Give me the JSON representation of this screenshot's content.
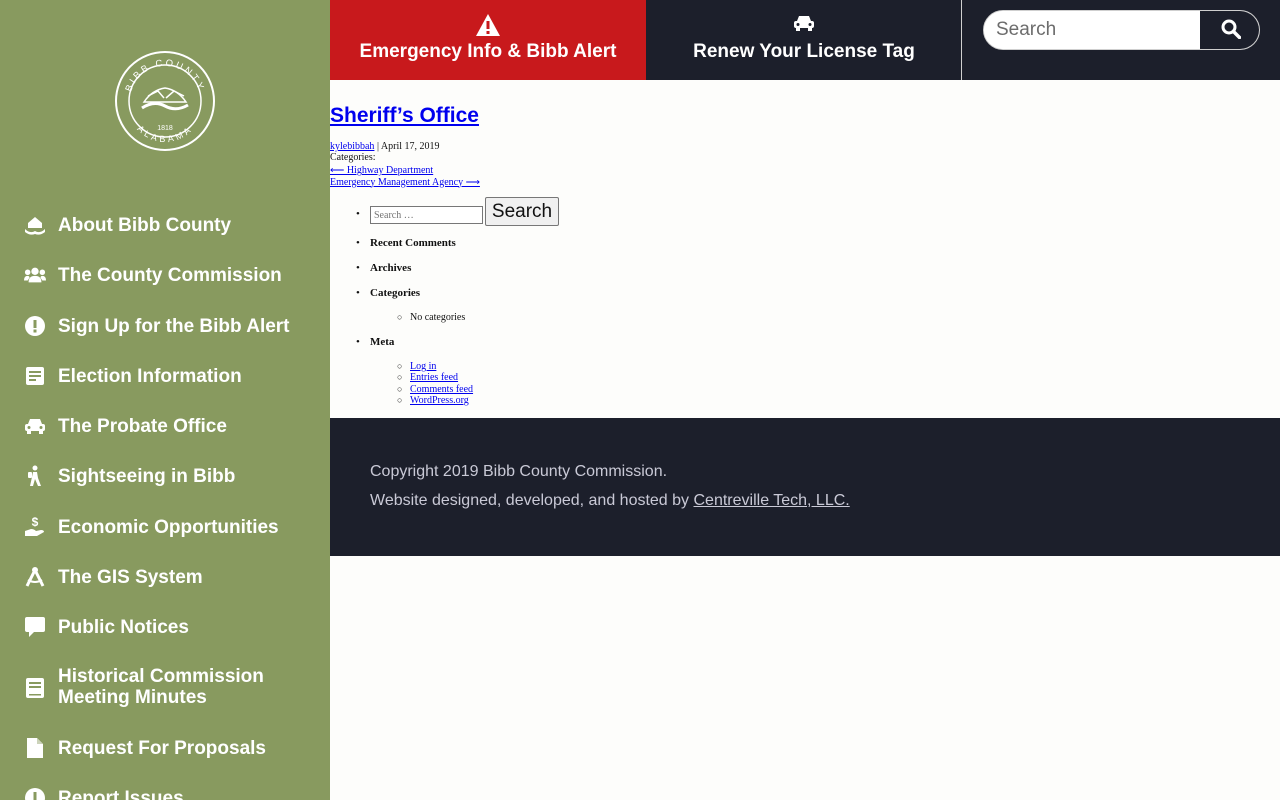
{
  "sidebar": {
    "seal": {
      "text_top": "BIBB COUNTY",
      "text_bottom": "ALABAMA",
      "year": "1818"
    },
    "items": [
      {
        "label": "About Bibb County",
        "icon": "hands-house-icon"
      },
      {
        "label": "The County Commission",
        "icon": "users-icon"
      },
      {
        "label": "Sign Up for the Bibb Alert",
        "icon": "exclamation-circle-icon"
      },
      {
        "label": "Election Information",
        "icon": "document-icon"
      },
      {
        "label": "The Probate Office",
        "icon": "car-icon"
      },
      {
        "label": "Sightseeing in Bibb",
        "icon": "hiker-icon"
      },
      {
        "label": "Economic Opportunities",
        "icon": "money-hand-icon"
      },
      {
        "label": "The GIS System",
        "icon": "compass-drafting-icon"
      },
      {
        "label": "Public Notices",
        "icon": "speech-bubble-icon"
      },
      {
        "label": "Historical Commission Meeting Minutes",
        "icon": "book-icon"
      },
      {
        "label": "Request For Proposals",
        "icon": "file-icon"
      },
      {
        "label": "Report Issues",
        "icon": "exclamation-circle-icon"
      }
    ]
  },
  "topbar": {
    "emergency_label": "Emergency Info & Bibb Alert",
    "tag_label": "Renew Your License Tag",
    "search_placeholder": "Search",
    "colors": {
      "emergency": "#c8191c",
      "bar": "#1c1f2b"
    }
  },
  "post": {
    "title": "Sheriff’s Office",
    "author": "kylebibbah",
    "separator": " | ",
    "date": "April 17, 2019",
    "categories_label": "Categories:",
    "prev_link": "⟵ Highway Department",
    "next_link": "Emergency Management Agency ⟶"
  },
  "widgets": {
    "search_placeholder": "Search …",
    "search_button": "Search",
    "recent_comments": "Recent Comments",
    "archives": "Archives",
    "categories": "Categories",
    "no_categories": "No categories",
    "meta": "Meta",
    "meta_links": [
      "Log in",
      "Entries feed",
      "Comments feed",
      "WordPress.org"
    ]
  },
  "footer": {
    "copyright": "Copyright 2019 Bibb County Commission.",
    "credit_prefix": "Website designed, developed, and hosted by ",
    "credit_link": "Centreville Tech, LLC."
  },
  "colors": {
    "sidebar": "#889a5f",
    "link": "#0000ee"
  }
}
